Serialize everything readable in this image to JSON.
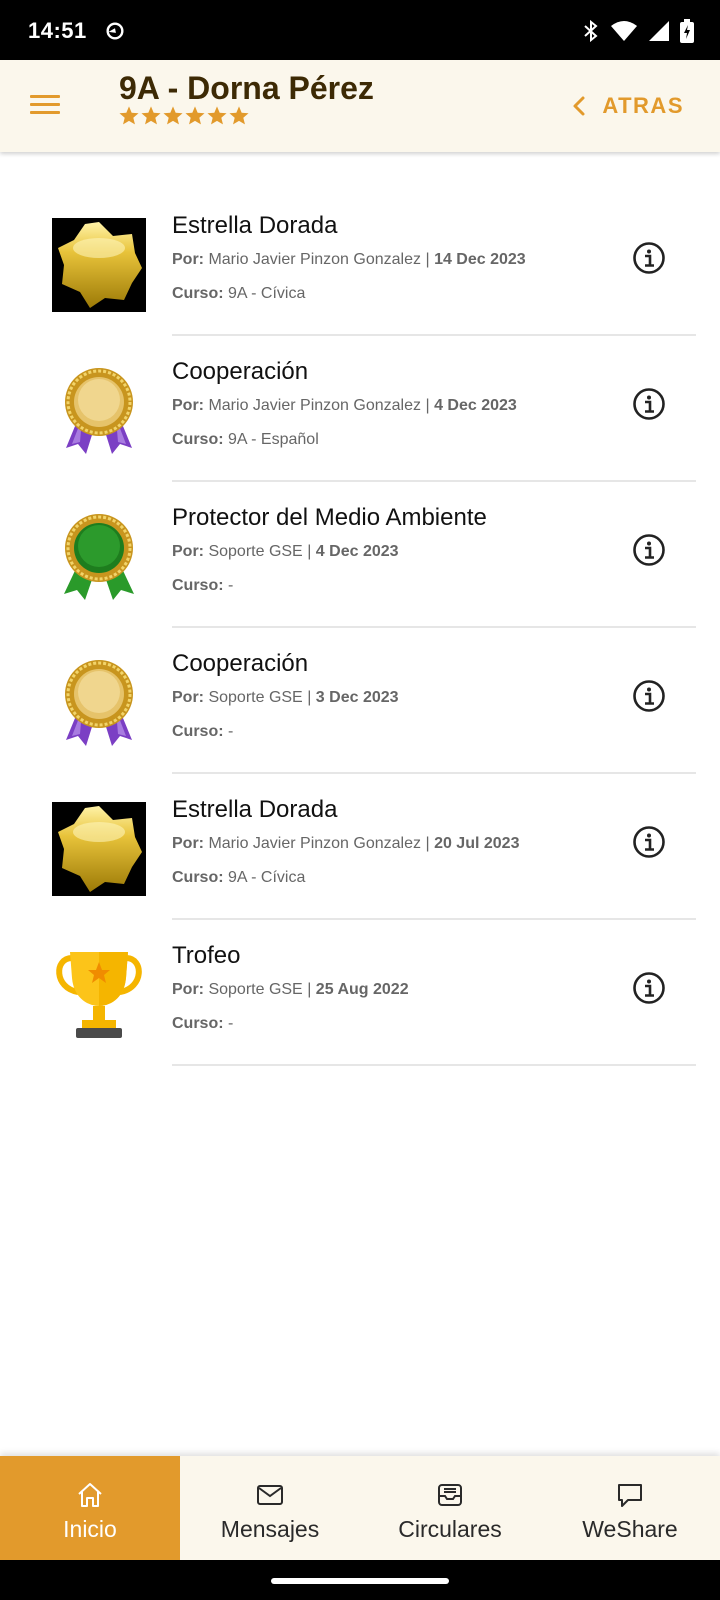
{
  "status_bar": {
    "time": "14:51",
    "icons": [
      "sync-icon",
      "bluetooth-icon",
      "wifi-icon",
      "signal-icon",
      "battery-icon"
    ]
  },
  "header": {
    "title": "9A - Dorna Pérez",
    "rating": 6,
    "rating_max": 6,
    "back_label": "ATRAS",
    "accent_color": "#e29a2c",
    "background_color": "#fbf7ec"
  },
  "labels": {
    "by": "Por:",
    "course": "Curso:",
    "separator": "|"
  },
  "awards": [
    {
      "title": "Estrella Dorada",
      "by": "Mario Javier Pinzon Gonzalez",
      "date": "14 Dec 2023",
      "course": "9A - Cívica",
      "icon": "gold-star-icon"
    },
    {
      "title": "Cooperación",
      "by": "Mario Javier Pinzon Gonzalez",
      "date": "4 Dec 2023",
      "course": "9A - Español",
      "icon": "gold-medal-purple-ribbon-icon"
    },
    {
      "title": "Protector del Medio Ambiente",
      "by": "Soporte GSE",
      "date": "4 Dec 2023",
      "course": "-",
      "icon": "green-medal-icon"
    },
    {
      "title": "Cooperación",
      "by": "Soporte GSE",
      "date": "3 Dec 2023",
      "course": "-",
      "icon": "gold-medal-purple-ribbon-icon"
    },
    {
      "title": "Estrella Dorada",
      "by": "Mario Javier Pinzon Gonzalez",
      "date": "20 Jul 2023",
      "course": "9A - Cívica",
      "icon": "gold-star-icon"
    },
    {
      "title": "Trofeo",
      "by": "Soporte GSE",
      "date": "25 Aug 2022",
      "course": "-",
      "icon": "trophy-icon"
    }
  ],
  "bottom_nav": {
    "tabs": [
      {
        "label": "Inicio",
        "icon": "home-icon",
        "active": true
      },
      {
        "label": "Mensajes",
        "icon": "envelope-icon",
        "active": false
      },
      {
        "label": "Circulares",
        "icon": "inbox-icon",
        "active": false
      },
      {
        "label": "WeShare",
        "icon": "chat-bubble-icon",
        "active": false
      }
    ]
  }
}
